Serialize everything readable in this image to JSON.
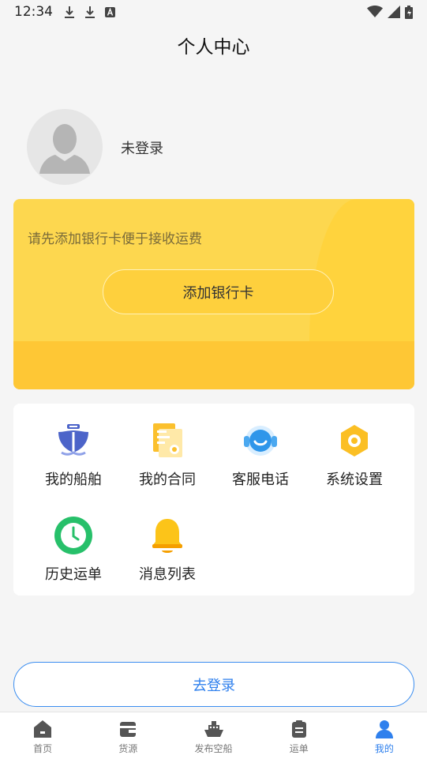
{
  "status_bar": {
    "time": "12:34"
  },
  "header": {
    "title": "个人中心"
  },
  "profile": {
    "login_status": "未登录"
  },
  "bank_card": {
    "hint": "请先添加银行卡便于接收运费",
    "button_label": "添加银行卡"
  },
  "features": [
    {
      "label": "我的船舶",
      "icon": "ship-icon"
    },
    {
      "label": "我的合同",
      "icon": "contract-icon"
    },
    {
      "label": "客服电话",
      "icon": "customer-service-icon"
    },
    {
      "label": "系统设置",
      "icon": "settings-icon"
    },
    {
      "label": "历史运单",
      "icon": "history-clock-icon"
    },
    {
      "label": "消息列表",
      "icon": "bell-icon"
    }
  ],
  "login_button": {
    "label": "去登录"
  },
  "tab_bar": {
    "active_index": 4,
    "items": [
      {
        "label": "首页",
        "icon": "home-icon"
      },
      {
        "label": "货源",
        "icon": "cargo-wallet-icon"
      },
      {
        "label": "发布空船",
        "icon": "publish-ship-icon"
      },
      {
        "label": "运单",
        "icon": "waybill-icon"
      },
      {
        "label": "我的",
        "icon": "user-icon"
      }
    ]
  },
  "colors": {
    "accent": "#2f80ed",
    "card_yellow": "#fdd74f",
    "button_yellow": "#fed03d"
  }
}
